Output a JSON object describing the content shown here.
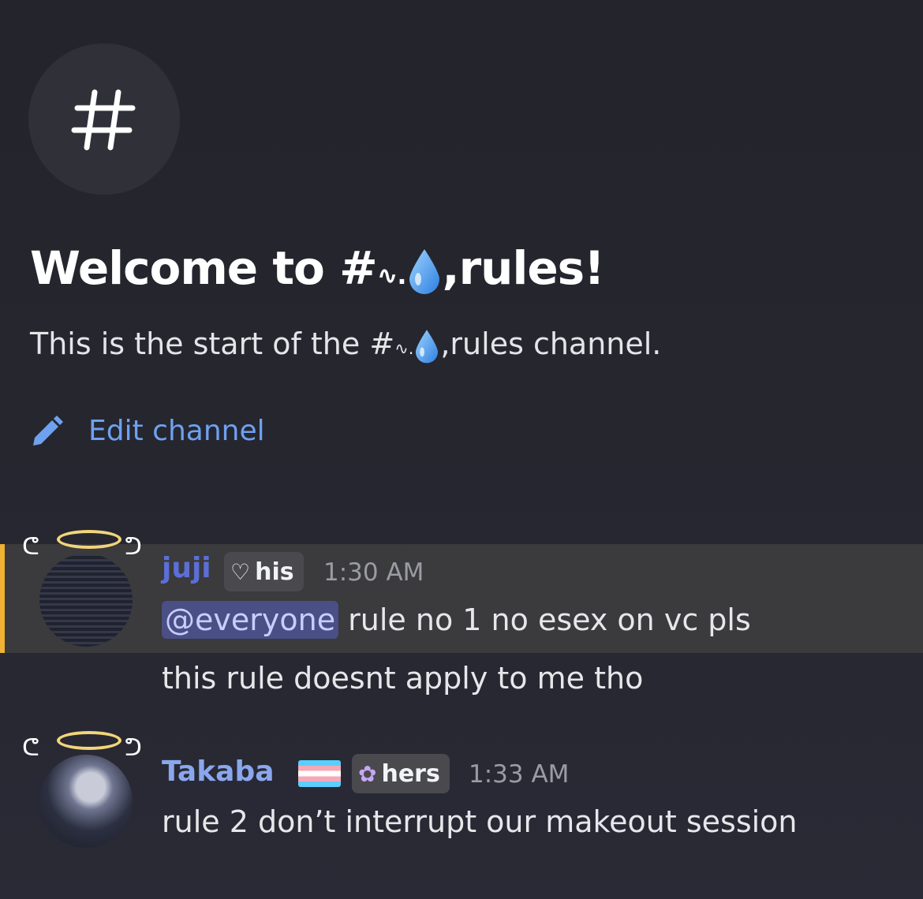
{
  "channel_intro": {
    "hash_symbol": "#",
    "welcome_prefix": "Welcome to #",
    "welcome_sym": "∿.",
    "welcome_suffix": ",rules!",
    "start_prefix": "This is the start of the #",
    "start_sym": "∿.",
    "start_suffix": ",rules channel.",
    "edit_label": "Edit channel"
  },
  "messages": [
    {
      "username": "juji",
      "pronoun": "his",
      "pronoun_icon": "heart-icon",
      "time": "1:30 AM",
      "mention": "@everyone",
      "line1": " rule no 1 no esex on vc pls",
      "line2": "this rule doesnt apply to me tho",
      "highlighted": true
    },
    {
      "username": "Takaba",
      "pronoun": "hers",
      "pronoun_icon": "flower-icon",
      "time": "1:33 AM",
      "line1": "rule 2 don’t interrupt our makeout session",
      "flag": "trans-flag-icon"
    }
  ],
  "colors": {
    "accent_link": "#6ea1f0",
    "highlight_bar": "#f0b232",
    "mention_bg": "#4a4f86",
    "juji_name": "#5b6fd6",
    "takaba_name": "#8aa7ee"
  }
}
